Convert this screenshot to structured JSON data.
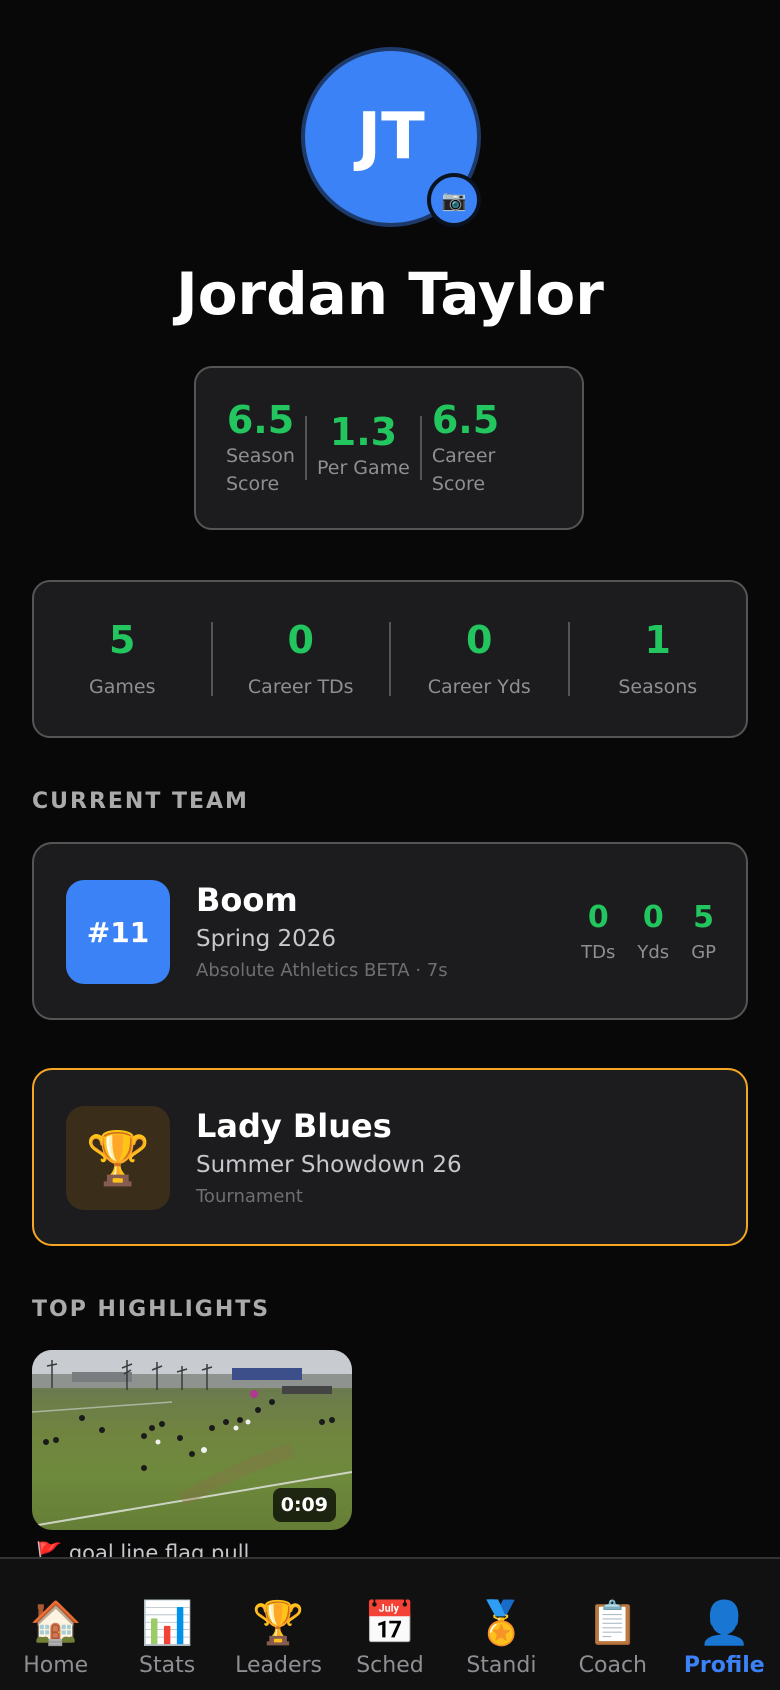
{
  "profile": {
    "initials": "JT",
    "name": "Jordan Taylor",
    "camera_icon": "camera-icon"
  },
  "scores": [
    {
      "value": "6.5",
      "label": "Season\nScore"
    },
    {
      "value": "1.3",
      "label": "Per Game"
    },
    {
      "value": "6.5",
      "label": "Career\nScore"
    }
  ],
  "career_stats": [
    {
      "value": "5",
      "label": "Games"
    },
    {
      "value": "0",
      "label": "Career TDs"
    },
    {
      "value": "0",
      "label": "Career Yds"
    },
    {
      "value": "1",
      "label": "Seasons"
    }
  ],
  "current_team": {
    "section_title": "CURRENT TEAM",
    "number": "#11",
    "name": "Boom",
    "season": "Spring 2026",
    "sub": "Absolute Athletics BETA · 7s",
    "stats": [
      {
        "value": "0",
        "label": "TDs"
      },
      {
        "value": "0",
        "label": "Yds"
      },
      {
        "value": "5",
        "label": "GP"
      }
    ]
  },
  "tournament": {
    "icon": "🏆",
    "name": "Lady Blues",
    "event": "Summer Showdown 26",
    "type": "Tournament"
  },
  "highlights": {
    "section_title": "TOP HIGHLIGHTS",
    "items": [
      {
        "duration": "0:09",
        "caption": "🚩 goal line flag pull"
      }
    ]
  },
  "tabs": [
    {
      "icon": "🏠",
      "label": "Home",
      "active": false
    },
    {
      "icon": "📊",
      "label": "Stats",
      "active": false
    },
    {
      "icon": "🏆",
      "label": "Leaders",
      "active": false
    },
    {
      "icon": "📅",
      "label": "Sched",
      "active": false
    },
    {
      "icon": "🏅",
      "label": "Standi",
      "active": false
    },
    {
      "icon": "📋",
      "label": "Coach",
      "active": false
    },
    {
      "icon": "👤",
      "label": "Profile",
      "active": true
    }
  ],
  "colors": {
    "accent": "#3b82f6",
    "stat_green": "#22c55e",
    "tournament_border": "#f5a623",
    "background": "#080808"
  }
}
